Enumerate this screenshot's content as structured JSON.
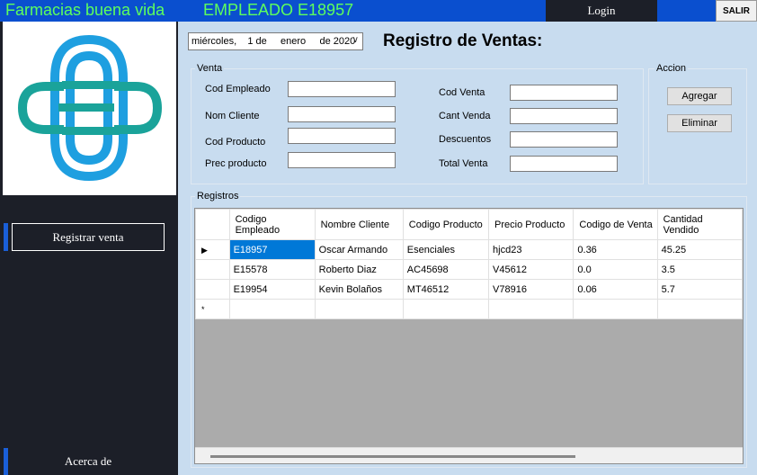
{
  "header": {
    "app_title": "Farmacias buena vida",
    "employee_title": "EMPLEADO E18957",
    "login_label": "Login",
    "exit_label": "SALIR"
  },
  "sidebar": {
    "register_sale_label": "Registrar venta",
    "about_label": "Acerca de"
  },
  "main": {
    "date": "miércoles,    1 de     enero     de 2020",
    "title": "Registro de Ventas:",
    "venta_group": "Venta",
    "accion_group": "Accion",
    "registros_group": "Registros",
    "fields": {
      "cod_empleado": {
        "label": "Cod Empleado",
        "value": ""
      },
      "nom_cliente": {
        "label": "Nom Cliente",
        "value": ""
      },
      "cod_producto": {
        "label": "Cod Producto",
        "value": ""
      },
      "prec_producto": {
        "label": "Prec producto",
        "value": ""
      },
      "cod_venta": {
        "label": "Cod Venta",
        "value": ""
      },
      "cant_venda": {
        "label": "Cant Venda",
        "value": ""
      },
      "descuentos": {
        "label": "Descuentos",
        "value": ""
      },
      "total_venta": {
        "label": "Total Venta",
        "value": ""
      }
    },
    "add_label": "Agregar",
    "delete_label": "Eliminar"
  },
  "grid": {
    "columns": [
      "Codigo Empleado",
      "Nombre Cliente",
      "Codigo Producto",
      "Precio Producto",
      "Codigo de Venta",
      "Cantidad Vendido"
    ],
    "rows": [
      [
        "E18957",
        "Oscar Armando",
        "Esenciales",
        "hjcd23",
        "0.36",
        "45.25"
      ],
      [
        "E15578",
        "Roberto Diaz",
        "AC45698",
        "V45612",
        "0.0",
        "3.5"
      ],
      [
        "E19954",
        "Kevin Bolaños",
        "MT46512",
        "V78916",
        "0.06",
        "5.7"
      ]
    ],
    "current_row_marker": "▶",
    "new_row_marker": "*"
  },
  "colors": {
    "topbar": "#0a4fcf",
    "title_green": "#5dff5d",
    "sidebar": "#1c1f28",
    "background": "#c8dcef",
    "logo_teal": "#1aa39a",
    "logo_blue": "#1e9fe0",
    "selection": "#0078d7"
  }
}
